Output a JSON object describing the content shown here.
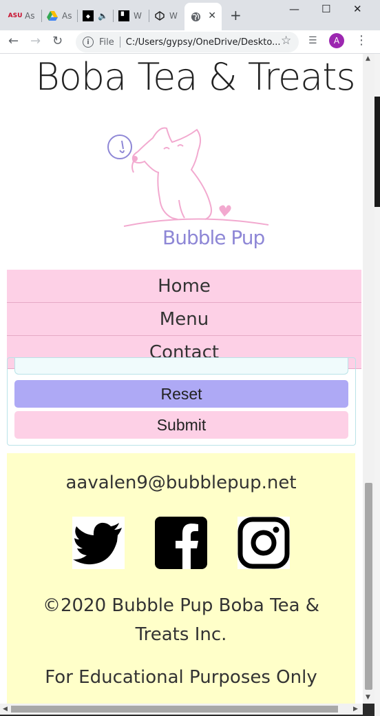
{
  "browser": {
    "tabs": [
      {
        "favicon": "ASU",
        "label": "As"
      },
      {
        "favicon": "drive-icon",
        "label": "As"
      },
      {
        "favicon": "tidal-icon",
        "label": "🔈"
      },
      {
        "favicon": "w-icon",
        "label": "W"
      },
      {
        "favicon": "codepen-icon",
        "label": "W"
      },
      {
        "favicon": "globe-icon",
        "label": "W"
      }
    ],
    "url_scheme": "File",
    "url": "C:/Users/gypsy/OneDrive/Deskto...",
    "avatar_initial": "A"
  },
  "site": {
    "title": "Boba Tea & Treats",
    "logo_text": "Bubble Pup"
  },
  "nav": {
    "items": [
      "Home",
      "Menu",
      "Contact"
    ]
  },
  "form": {
    "reset_label": "Reset",
    "submit_label": "Submit"
  },
  "footer": {
    "email": "aavalen9@bubblepup.net",
    "social": [
      "twitter-icon",
      "facebook-icon",
      "instagram-icon"
    ],
    "copyright": "©2020 Bubble Pup Boba Tea & Treats Inc.",
    "disclaimer": "For Educational Purposes Only"
  },
  "colors": {
    "nav_pink": "#fdd0e6",
    "reset_purple": "#aea9f5",
    "footer_yellow": "#ffffc9",
    "logo_pink": "#f2a9cf",
    "logo_purple": "#8e87d6"
  }
}
